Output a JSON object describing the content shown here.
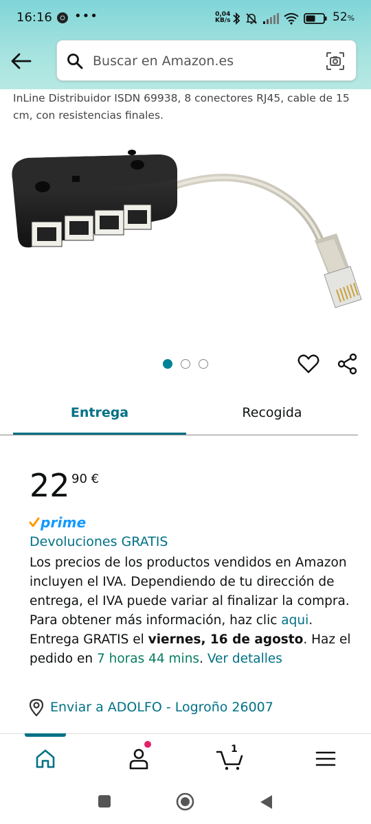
{
  "status_bar": {
    "time": "16:16",
    "dots": "•••",
    "speed_value": "0,04",
    "speed_unit": "KB/s",
    "battery_percent": "52"
  },
  "search": {
    "placeholder": "Buscar en Amazon.es"
  },
  "product": {
    "title": "InLine Distribuidor ISDN 69938, 8 conectores RJ45, cable de 15 cm, con resistencias finales.",
    "image_count": 3,
    "active_image_index": 0
  },
  "tabs": {
    "delivery": "Entrega",
    "pickup": "Recogida"
  },
  "price": {
    "whole": "22",
    "fraction": "90 €"
  },
  "prime": {
    "label": "prime",
    "color": "#1399ff",
    "check_color": "#ff9900"
  },
  "returns_link": "Devoluciones GRATIS",
  "tax_text": {
    "body": "Los precios de los productos vendidos en Amazon incluyen el IVA. Dependiendo de tu dirección de entrega, el IVA puede variar al finalizar la compra. Para obtener más información, haz clic ",
    "link": "aqui",
    "end": "."
  },
  "delivery_text": {
    "prefix": "Entrega GRATIS el ",
    "date": "viernes, 16 de agosto",
    "middle": ". Haz el pedido en ",
    "countdown": "7 horas 44 mins",
    "separator": ". ",
    "details_link": "Ver detalles"
  },
  "ship_to": "Enviar a ADOLFO - Logroño 26007",
  "bottom_nav": {
    "cart_count": "1",
    "items": [
      "home-icon",
      "account-icon",
      "cart-icon",
      "menu-icon"
    ]
  },
  "colors": {
    "accent": "#007185",
    "header_gradient_start": "#7fd5d8",
    "header_gradient_end": "#b7e9e3",
    "link": "#007185",
    "green": "#067d62",
    "notification": "#e3226a"
  }
}
